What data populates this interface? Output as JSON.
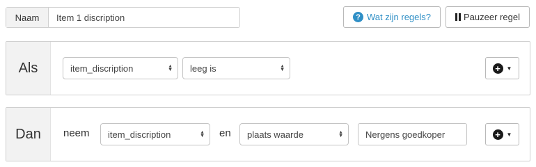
{
  "header": {
    "name_label": "Naam",
    "name_value": "Item 1 discription",
    "rules_button_label": "Wat zijn regels?",
    "pause_button_label": "Pauzeer regel"
  },
  "if_block": {
    "label": "Als",
    "field_select": "item_discription",
    "condition_select": "leeg is"
  },
  "then_block": {
    "label": "Dan",
    "verb": "neem",
    "field_select": "item_discription",
    "connector": "en",
    "action_select": "plaats waarde",
    "value_input": "Nergens goedkoper"
  },
  "colors": {
    "accent": "#2f8fc6",
    "label_bg": "#f2f2f2",
    "border": "#cfcfcf"
  },
  "icons": {
    "help": "question-circle-icon",
    "pause": "pause-icon",
    "add": "plus-circle-icon",
    "caret": "caret-down-icon",
    "select_arrows": "up-down-arrows-icon"
  }
}
